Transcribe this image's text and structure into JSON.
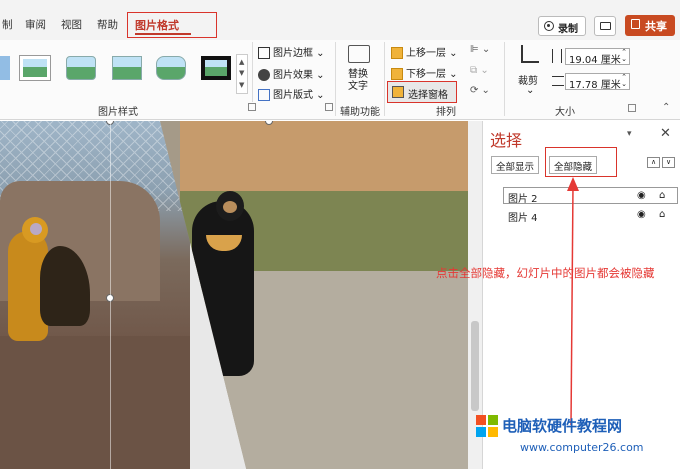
{
  "tabs": [
    {
      "label": "制"
    },
    {
      "label": "审阅"
    },
    {
      "label": "视图"
    },
    {
      "label": "帮助"
    },
    {
      "label": "图片格式"
    }
  ],
  "top_buttons": {
    "record": "录制",
    "share": "共享"
  },
  "picture_styles": {
    "group_label": "图片样式",
    "border": "图片边框",
    "effects": "图片效果",
    "layout": "图片版式"
  },
  "accessibility": {
    "alt_text": "替换\n文字",
    "group_label": "辅助功能"
  },
  "arrange": {
    "bring_forward": "上移一层",
    "send_backward": "下移一层",
    "selection_pane": "选择窗格",
    "group_label": "排列"
  },
  "size": {
    "crop": "裁剪",
    "height": "19.04 厘米",
    "width": "17.78 厘米",
    "group_label": "大小"
  },
  "pane": {
    "title": "选择",
    "show_all": "全部显示",
    "hide_all": "全部隐藏",
    "items": [
      {
        "label": "图片 2"
      },
      {
        "label": "图片 4"
      }
    ]
  },
  "annotation": "点击全部隐藏，幻灯片中的图片都会被隐藏",
  "watermark": {
    "title": "电脑软硬件教程网",
    "url": "www.computer26.com"
  },
  "colors": {
    "accent": "#c0392b",
    "share_bg": "#c84a21",
    "annotation": "#e53935"
  }
}
